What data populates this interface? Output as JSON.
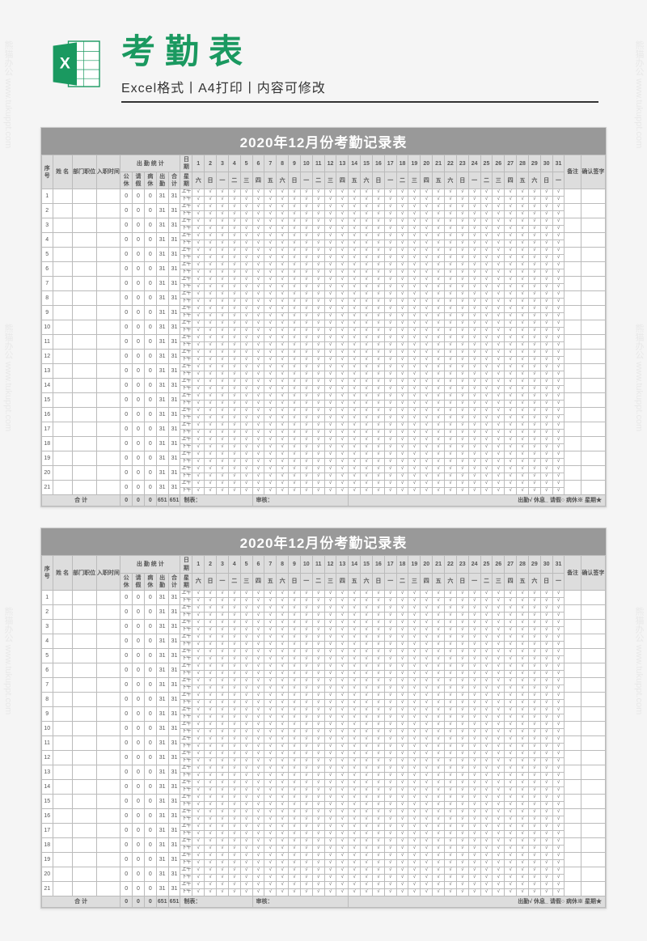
{
  "watermark": "熊猫办公 www.tukuppt.com",
  "header": {
    "title": "考勤表",
    "subtitle": "Excel格式丨A4打印丨内容可修改"
  },
  "sheet": {
    "title": "2020年12月份考勤记录表",
    "head": {
      "seq": "序号",
      "name": "姓 名",
      "dept": "部门职位",
      "hire": "入职时间",
      "stat_group": "出 勤 统 计",
      "stat_gx": "公休",
      "stat_qj": "请假",
      "stat_bx": "病休",
      "stat_cq": "出勤",
      "stat_hj": "合计",
      "date_label": "日期",
      "week_label": "星期",
      "remark": "备注",
      "sign": "确认签字"
    },
    "days": [
      "1",
      "2",
      "3",
      "4",
      "5",
      "6",
      "7",
      "8",
      "9",
      "10",
      "11",
      "12",
      "13",
      "14",
      "15",
      "16",
      "17",
      "18",
      "19",
      "20",
      "21",
      "22",
      "23",
      "24",
      "25",
      "26",
      "27",
      "28",
      "29",
      "30",
      "31"
    ],
    "weekdays": [
      "六",
      "日",
      "一",
      "二",
      "三",
      "四",
      "五",
      "六",
      "日",
      "一",
      "二",
      "三",
      "四",
      "五",
      "六",
      "日",
      "一",
      "二",
      "三",
      "四",
      "五",
      "六",
      "日",
      "一",
      "二",
      "三",
      "四",
      "五",
      "六",
      "日",
      "一"
    ],
    "period_am": "上午",
    "period_pm": "下午",
    "rows": [
      {
        "seq": "1",
        "stat": [
          "0",
          "0",
          "0",
          "31",
          "31"
        ]
      },
      {
        "seq": "2",
        "stat": [
          "0",
          "0",
          "0",
          "31",
          "31"
        ]
      },
      {
        "seq": "3",
        "stat": [
          "0",
          "0",
          "0",
          "31",
          "31"
        ]
      },
      {
        "seq": "4",
        "stat": [
          "0",
          "0",
          "0",
          "31",
          "31"
        ]
      },
      {
        "seq": "5",
        "stat": [
          "0",
          "0",
          "0",
          "31",
          "31"
        ]
      },
      {
        "seq": "6",
        "stat": [
          "0",
          "0",
          "0",
          "31",
          "31"
        ]
      },
      {
        "seq": "7",
        "stat": [
          "0",
          "0",
          "0",
          "31",
          "31"
        ]
      },
      {
        "seq": "8",
        "stat": [
          "0",
          "0",
          "0",
          "31",
          "31"
        ]
      },
      {
        "seq": "9",
        "stat": [
          "0",
          "0",
          "0",
          "31",
          "31"
        ]
      },
      {
        "seq": "10",
        "stat": [
          "0",
          "0",
          "0",
          "31",
          "31"
        ]
      },
      {
        "seq": "11",
        "stat": [
          "0",
          "0",
          "0",
          "31",
          "31"
        ]
      },
      {
        "seq": "12",
        "stat": [
          "0",
          "0",
          "0",
          "31",
          "31"
        ]
      },
      {
        "seq": "13",
        "stat": [
          "0",
          "0",
          "0",
          "31",
          "31"
        ]
      },
      {
        "seq": "14",
        "stat": [
          "0",
          "0",
          "0",
          "31",
          "31"
        ]
      },
      {
        "seq": "15",
        "stat": [
          "0",
          "0",
          "0",
          "31",
          "31"
        ]
      },
      {
        "seq": "16",
        "stat": [
          "0",
          "0",
          "0",
          "31",
          "31"
        ]
      },
      {
        "seq": "17",
        "stat": [
          "0",
          "0",
          "0",
          "31",
          "31"
        ]
      },
      {
        "seq": "18",
        "stat": [
          "0",
          "0",
          "0",
          "31",
          "31"
        ]
      },
      {
        "seq": "19",
        "stat": [
          "0",
          "0",
          "0",
          "31",
          "31"
        ]
      },
      {
        "seq": "20",
        "stat": [
          "0",
          "0",
          "0",
          "31",
          "31"
        ]
      },
      {
        "seq": "21",
        "stat": [
          "0",
          "0",
          "0",
          "31",
          "31"
        ]
      }
    ],
    "mark": "√",
    "total": {
      "label": "合 计",
      "values": [
        "0",
        "0",
        "0",
        "651",
        "651"
      ]
    },
    "footer": {
      "made": "制表：",
      "check": "审核：",
      "legend": "出勤√ 休息_ 请假○ 病休※ 星期★"
    }
  }
}
